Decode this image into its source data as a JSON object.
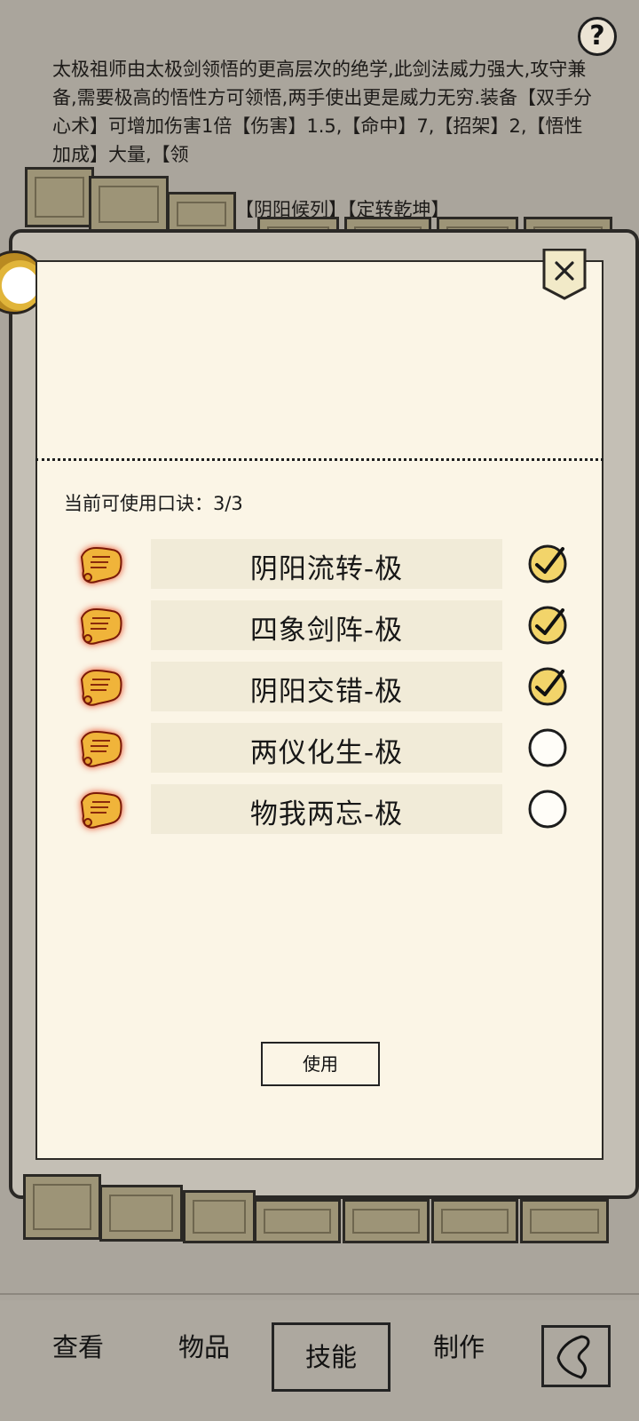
{
  "top": {
    "help_icon": "question-mark-icon",
    "help_glyph": "?"
  },
  "description": {
    "text": "太极祖师由太极剑领悟的更高层次的绝学,此剑法威力强大,攻守兼备,需要极高的悟性方可领悟,两手使出更是威力无穷.装备【双手分心术】可增加伤害1倍【伤害】1.5,【命中】7,【招架】2,【悟性加成】大量,【领",
    "tail": "【阴阳候列】【定转乾坤】"
  },
  "dialog": {
    "close_icon": "close-icon",
    "close_glyph": "×",
    "count_label": "当前可使用口诀：",
    "count_value": "3/3",
    "skills": [
      {
        "name": "阴阳流转-极",
        "checked": true,
        "icon": "scroll-icon"
      },
      {
        "name": "四象剑阵-极",
        "checked": true,
        "icon": "scroll-icon"
      },
      {
        "name": "阴阳交错-极",
        "checked": true,
        "icon": "scroll-icon"
      },
      {
        "name": "两仪化生-极",
        "checked": false,
        "icon": "scroll-icon"
      },
      {
        "name": "物我两忘-极",
        "checked": false,
        "icon": "scroll-icon"
      }
    ],
    "use_button": "使用"
  },
  "nav": {
    "tabs": [
      {
        "label": "查看"
      },
      {
        "label": "物品"
      },
      {
        "label": "技能"
      },
      {
        "label": "制作"
      }
    ],
    "active_tab": "技能",
    "back_icon": "back-arrow-icon"
  }
}
